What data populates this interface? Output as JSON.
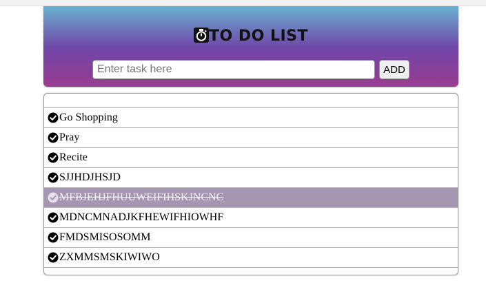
{
  "header": {
    "title": "TO DO LIST",
    "title_icon": "stopwatch-icon"
  },
  "input": {
    "placeholder": "Enter task here",
    "value": ""
  },
  "add_button": {
    "label": "ADD"
  },
  "tasks": [
    {
      "label": "Go Shopping",
      "done": false,
      "icon": "check-circle-icon"
    },
    {
      "label": "Pray",
      "done": false,
      "icon": "check-circle-icon"
    },
    {
      "label": "Recite",
      "done": false,
      "icon": "check-circle-icon"
    },
    {
      "label": "SJJHDJHSJD",
      "done": false,
      "icon": "check-circle-icon"
    },
    {
      "label": "MFBJEHJFHUUWEIFIHSKJNCNC",
      "done": true,
      "icon": "check-circle-icon"
    },
    {
      "label": "MDNCMNADJKFHEWIFHIOWHF",
      "done": false,
      "icon": "check-circle-icon"
    },
    {
      "label": "FMDSMISOSOMM",
      "done": false,
      "icon": "check-circle-icon"
    },
    {
      "label": "ZXMMSMSKIWIWO",
      "done": false,
      "icon": "check-circle-icon"
    }
  ],
  "colors": {
    "header_gradient_top": "#6ab0d0",
    "header_gradient_mid": "#6f46a8",
    "header_gradient_bottom": "#9a3c8f",
    "done_row_bg": "#a596b2",
    "done_icon": "#e6e0ec",
    "check_icon": "#000000"
  }
}
